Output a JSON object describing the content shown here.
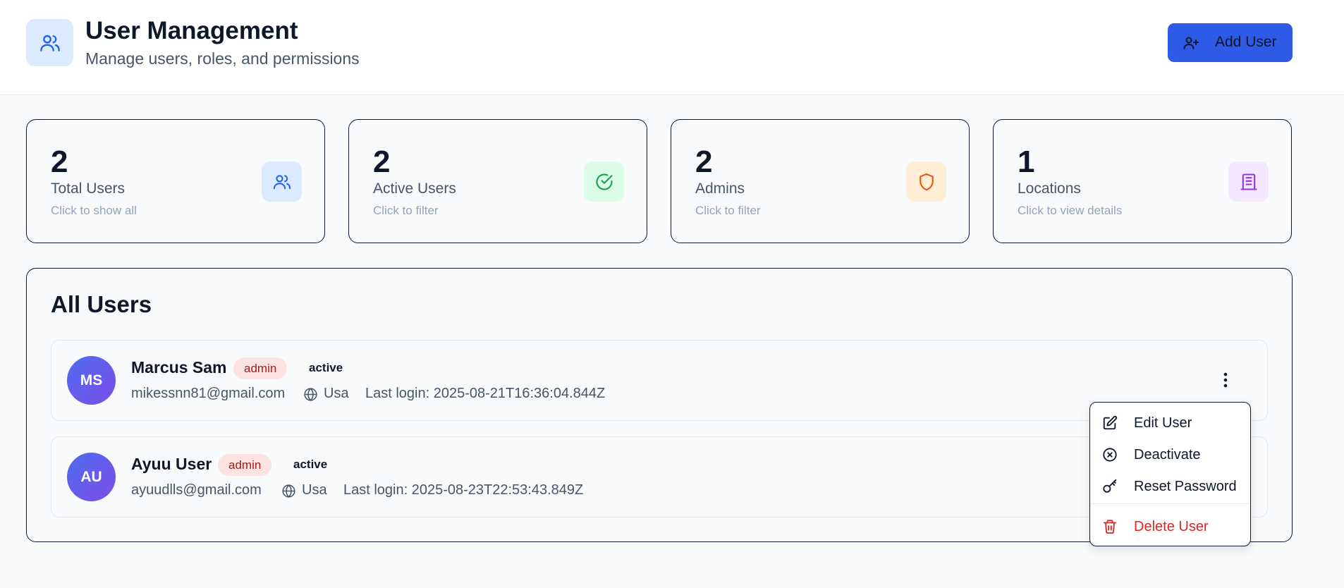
{
  "header": {
    "title": "User Management",
    "subtitle": "Manage users, roles, and permissions",
    "add_user_label": "Add User"
  },
  "stats": [
    {
      "value": "2",
      "label": "Total Users",
      "hint": "Click to show all",
      "icon": "users-icon",
      "icon_bg": "#dbeafe",
      "icon_color": "#2563eb"
    },
    {
      "value": "2",
      "label": "Active Users",
      "hint": "Click to filter",
      "icon": "check-circle-icon",
      "icon_bg": "#dcfce7",
      "icon_color": "#16a34a"
    },
    {
      "value": "2",
      "label": "Admins",
      "hint": "Click to filter",
      "icon": "shield-icon",
      "icon_bg": "#ffedd5",
      "icon_color": "#ea580c"
    },
    {
      "value": "1",
      "label": "Locations",
      "hint": "Click to view details",
      "icon": "building-icon",
      "icon_bg": "#f3e8ff",
      "icon_color": "#9333ea"
    }
  ],
  "users_panel": {
    "title": "All Users",
    "users": [
      {
        "initials": "MS",
        "name": "Marcus Sam",
        "role": "admin",
        "status": "active",
        "email": "mikessnn81@gmail.com",
        "location": "Usa",
        "last_login": "Last login: 2025-08-21T16:36:04.844Z"
      },
      {
        "initials": "AU",
        "name": "Ayuu User",
        "role": "admin",
        "status": "active",
        "email": "ayuudlls@gmail.com",
        "location": "Usa",
        "last_login": "Last login: 2025-08-23T22:53:43.849Z"
      }
    ]
  },
  "action_menu": {
    "items": [
      {
        "label": "Edit User",
        "icon": "edit-icon"
      },
      {
        "label": "Deactivate",
        "icon": "x-circle-icon"
      },
      {
        "label": "Reset Password",
        "icon": "key-icon"
      },
      {
        "label": "Delete User",
        "icon": "trash-icon",
        "danger": true
      }
    ]
  },
  "colors": {
    "accent": "#2f5ae6",
    "danger": "#dc2626",
    "role_badge_bg": "#fde2e2",
    "role_badge_text": "#9b1c1c"
  }
}
